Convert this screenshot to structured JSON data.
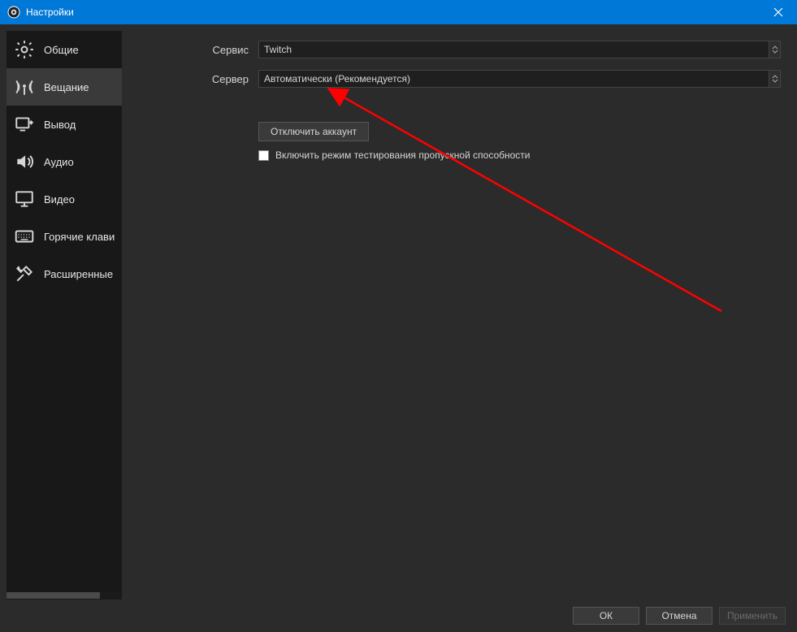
{
  "window": {
    "title": "Настройки"
  },
  "sidebar": {
    "items": [
      {
        "label": "Общие"
      },
      {
        "label": "Вещание"
      },
      {
        "label": "Вывод"
      },
      {
        "label": "Аудио"
      },
      {
        "label": "Видео"
      },
      {
        "label": "Горячие клавиши"
      },
      {
        "label": "Расширенные"
      }
    ]
  },
  "form": {
    "service_label": "Сервис",
    "server_label": "Сервер",
    "service_value": "Twitch",
    "server_value": "Автоматически (Рекомендуется)",
    "disconnect_button": "Отключить аккаунт",
    "bandwidth_test_label": "Включить режим тестирования пропускной способности"
  },
  "footer": {
    "ok": "ОК",
    "cancel": "Отмена",
    "apply": "Применить"
  }
}
